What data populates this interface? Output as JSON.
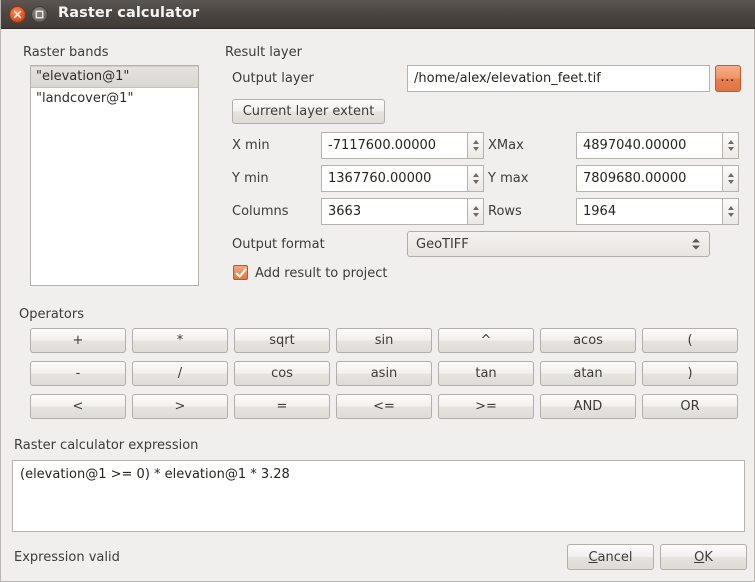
{
  "window": {
    "title": "Raster calculator",
    "close_icon": "close-icon",
    "maximize_icon": "maximize-icon"
  },
  "raster_bands": {
    "label": "Raster bands",
    "items": [
      {
        "name": "\"elevation@1\"",
        "selected": true
      },
      {
        "name": "\"landcover@1\"",
        "selected": false
      }
    ]
  },
  "result_layer": {
    "label": "Result layer",
    "output_layer_label": "Output layer",
    "output_layer_value": "/home/alex/elevation_feet.tif",
    "output_layer_placeholder": "",
    "browse_button_label": "...",
    "current_extent_button": "Current layer extent",
    "extent": {
      "xmin_label": "X min",
      "xmin_value": "-7117600.00000",
      "xmax_label": "XMax",
      "xmax_value": "4897040.00000",
      "ymin_label": "Y min",
      "ymin_value": "1367760.00000",
      "ymax_label": "Y max",
      "ymax_value": "7809680.00000",
      "columns_label": "Columns",
      "columns_value": "3663",
      "rows_label": "Rows",
      "rows_value": "1964"
    },
    "output_format_label": "Output format",
    "output_format_value": "GeoTIFF",
    "output_format_options": [
      "GeoTIFF"
    ],
    "add_to_project_label": "Add result to project",
    "add_to_project_checked": true
  },
  "operators": {
    "label": "Operators",
    "rows": [
      [
        "+",
        "*",
        "sqrt",
        "sin",
        "^",
        "acos",
        "("
      ],
      [
        "-",
        "/",
        "cos",
        "asin",
        "tan",
        "atan",
        ")"
      ],
      [
        "<",
        ">",
        "=",
        "<=",
        ">=",
        "AND",
        "OR"
      ]
    ]
  },
  "expression": {
    "label": "Raster calculator expression",
    "value": "(elevation@1 >= 0) * elevation@1 * 3.28"
  },
  "footer": {
    "status": "Expression valid",
    "cancel_label": "Cancel",
    "ok_label": "OK"
  },
  "colors": {
    "accent_orange": "#e8763d",
    "titlebar": "#4b4542",
    "dialog_bg": "#f0efee"
  }
}
